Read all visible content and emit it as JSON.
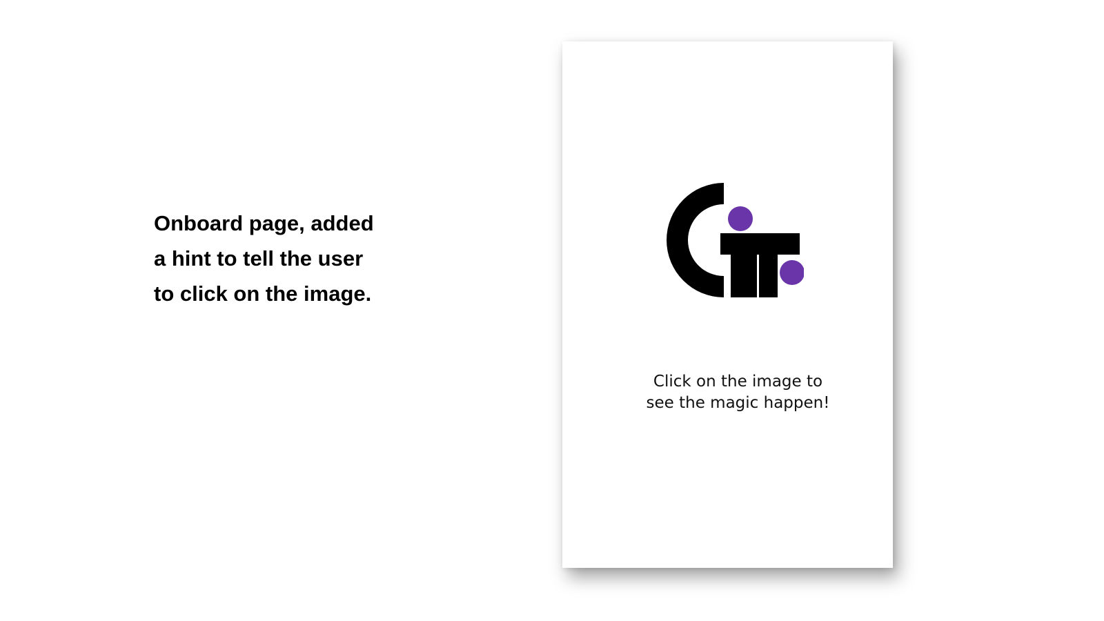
{
  "annotation": {
    "lines": [
      "Onboard page, added",
      "a hint to tell the user",
      "to click on the image."
    ]
  },
  "onboard": {
    "logo": {
      "icon": "gif-logo-icon",
      "foreground_color": "#000000",
      "accent_color": "#6a35a8"
    },
    "hint_lines": [
      "Click on the image to",
      "see the magic happen!"
    ]
  }
}
